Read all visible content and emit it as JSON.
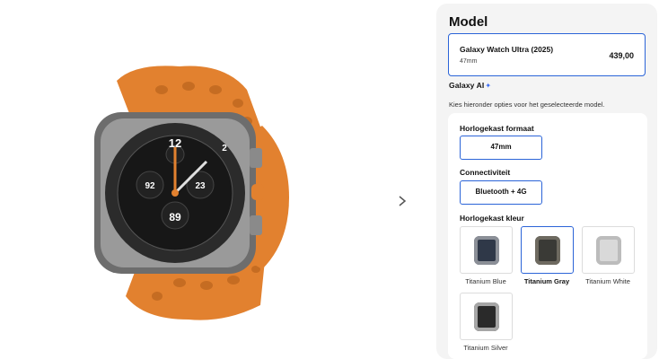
{
  "gallery": {
    "image_alt": "Galaxy Watch Ultra oranje band",
    "next_icon": "chevron-right-icon",
    "watch_face": {
      "numerals_top": "12",
      "numeral_2": "2",
      "numeral_left": "92",
      "numeral_right": "23",
      "numeral_bottom": "89"
    }
  },
  "panel": {
    "title": "Model",
    "model": {
      "name": "Galaxy Watch Ultra (2025)",
      "size": "47mm",
      "price": "439,00"
    },
    "galaxy_ai": {
      "label": "Galaxy AI",
      "sparkle": "✦"
    },
    "help_text": "Kies hieronder opties voor het geselecteerde model.",
    "case_size": {
      "label": "Horlogekast formaat",
      "value": "47mm"
    },
    "connectivity": {
      "label": "Connectiviteit",
      "value": "Bluetooth + 4G"
    },
    "case_color": {
      "label": "Horlogekast kleur",
      "options": [
        {
          "name": "Titanium Blue",
          "selected": false,
          "color": "#2f3848"
        },
        {
          "name": "Titanium Gray",
          "selected": true,
          "color": "#3a3a36"
        },
        {
          "name": "Titanium White",
          "selected": false,
          "color": "#d9d9d9"
        },
        {
          "name": "Titanium Silver",
          "selected": false,
          "color": "#2a2a2a"
        }
      ]
    }
  },
  "colors": {
    "accent_blue": "#2b64d8",
    "band_orange": "#e2812f",
    "panel_bg": "#f4f4f4"
  }
}
